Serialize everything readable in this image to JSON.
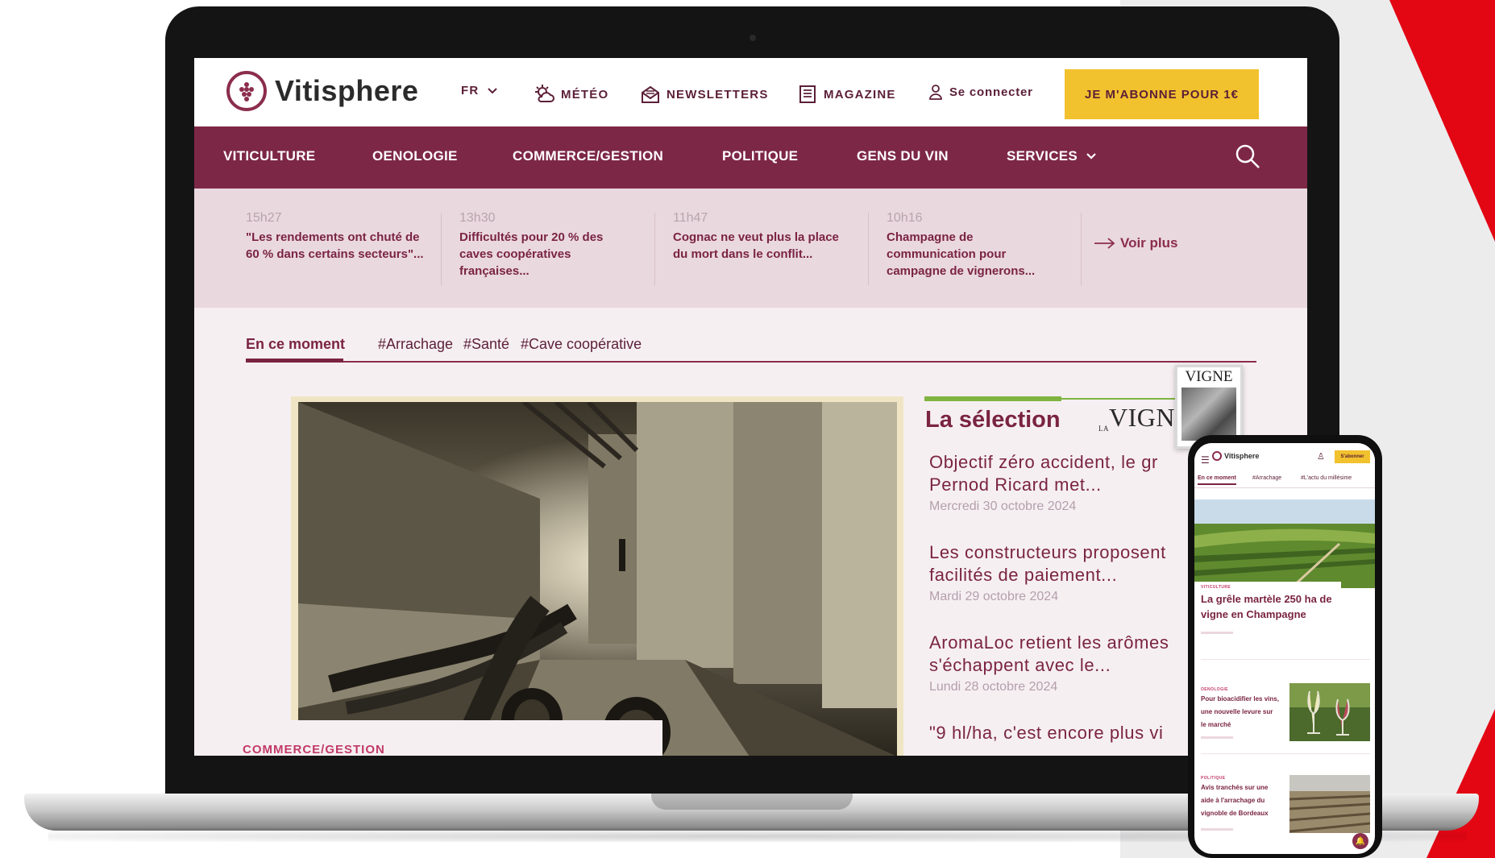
{
  "header": {
    "brand": "Vitisphere",
    "lang": "FR",
    "meteo": "MÉTÉO",
    "newsletters": "NEWSLETTERS",
    "magazine": "MAGAZINE",
    "login": "Se connecter",
    "subscribe": "JE M'ABONNE POUR 1€"
  },
  "nav": {
    "items": [
      "VITICULTURE",
      "OENOLOGIE",
      "COMMERCE/GESTION",
      "POLITIQUE",
      "GENS DU VIN",
      "SERVICES"
    ]
  },
  "ticker": {
    "items": [
      {
        "time": "15h27",
        "headline": "\"Les rendements ont chuté de 60 % dans certains secteurs\"..."
      },
      {
        "time": "13h30",
        "headline": "Difficultés pour 20 % des caves coopératives françaises..."
      },
      {
        "time": "11h47",
        "headline": "Cognac ne veut plus la place du mort dans le conflit..."
      },
      {
        "time": "10h16",
        "headline": "Champagne de communication pour campagne de vignerons..."
      }
    ],
    "more": "Voir plus"
  },
  "tabs": [
    "En ce moment",
    "#Arrachage",
    "#Santé",
    "#Cave coopérative"
  ],
  "feature": {
    "category": "COMMERCE/GESTION"
  },
  "selection": {
    "title": "La sélection",
    "partner": "VIGNE",
    "partner_prefix": "LA",
    "articles": [
      {
        "title_l1": "Objectif zéro accident, le gr",
        "title_l2": "Pernod Ricard met...",
        "date": "Mercredi 30 octobre 2024"
      },
      {
        "title_l1": "Les constructeurs proposent",
        "title_l2": "facilités de paiement...",
        "date": "Mardi 29 octobre 2024"
      },
      {
        "title_l1": "AromaLoc retient les arômes",
        "title_l2": "s'échappent avec le...",
        "date": "Lundi 28 octobre 2024"
      },
      {
        "title_l1": "\"9 hl/ha, c'est encore plus vi",
        "title_l2": "",
        "date": ""
      }
    ]
  },
  "magazine_cover": {
    "title": "VIGNE"
  },
  "phone": {
    "brand": "Vitisphere",
    "subscribe": "S'abonner",
    "tabs": [
      "En ce moment",
      "#Arrachage",
      "#L'actu du millésime"
    ],
    "hero_category": "VITICULTURE",
    "hero_headline": "La grêle martèle 250 ha de vigne en Champagne",
    "item1_category": "OENOLOGIE",
    "item1_headline": "Pour bioacidifier les vins, une nouvelle levure sur le marché",
    "item2_category": "POLITIQUE",
    "item2_headline": "Avis tranchés sur une aide à l'arrachage du vignoble de Bordeaux"
  },
  "colors": {
    "brand": "#7d2746",
    "accent": "#f2c12e",
    "selection_green": "#7fb441",
    "decor_red": "#e30613"
  }
}
